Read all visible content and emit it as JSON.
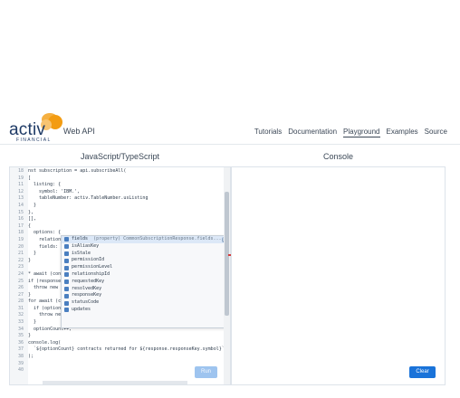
{
  "header": {
    "logo_word": "activ",
    "logo_sub": "FINANCIAL",
    "title": "Web API",
    "nav": [
      "Tutorials",
      "Documentation",
      "Playground",
      "Examples",
      "Source"
    ],
    "active_nav": "Playground"
  },
  "left_pane": {
    "title": "JavaScript/TypeScript"
  },
  "right_pane": {
    "title": "Console"
  },
  "editor": {
    "lines": [
      {
        "num": "18",
        "code": "nst subscription = api.subscribeAll("
      },
      {
        "num": "19",
        "code": "["
      },
      {
        "num": "11",
        "code": "  listing: {"
      },
      {
        "num": "12",
        "code": "    symbol: 'IBM.',"
      },
      {
        "num": "13",
        "code": "    tableNumber: activ.TableNumber.usListing"
      },
      {
        "num": "14",
        "code": "  }"
      },
      {
        "num": "15",
        "code": "},"
      },
      {
        "num": "16",
        "code": "[],"
      },
      {
        "num": "17",
        "code": "{"
      },
      {
        "num": "18",
        "code": "  options: {"
      },
      {
        "num": "19",
        "code": "    relations"
      },
      {
        "num": "20",
        "code": "    fields: ["
      },
      {
        "num": "21",
        "code": "  }"
      },
      {
        "num": "22",
        "code": "}"
      },
      {
        "num": "23",
        "code": ""
      },
      {
        "num": "24",
        "code": "* await (cons"
      },
      {
        "num": "25",
        "code": "if (response."
      },
      {
        "num": "26",
        "code": "  throw new a"
      },
      {
        "num": "27",
        "code": "}"
      },
      {
        "num": "28",
        "code": "for await (co"
      },
      {
        "num": "31",
        "code": "  if (option."
      },
      {
        "num": "32",
        "code": "    throw new activ.StatusCodeError(option.statusCode);"
      },
      {
        "num": "33",
        "code": "  }"
      },
      {
        "num": "34",
        "code": "  optionCount++;"
      },
      {
        "num": "35",
        "code": "}"
      },
      {
        "num": "36",
        "code": "console.log("
      },
      {
        "num": "37",
        "code": "  `${optionCount} contracts returned for ${response.responseKey.symbol}`"
      },
      {
        "num": "38",
        "code": ");"
      },
      {
        "num": "39",
        "code": ""
      },
      {
        "num": "40",
        "code": ""
      }
    ],
    "line31_tail": "== activ.StatusCode.success) {"
  },
  "autocomplete": {
    "items": [
      {
        "label": "fields",
        "detail": "(property) CommonSubscriptionResponse.fields..."
      },
      {
        "label": "isAliasKey",
        "detail": ""
      },
      {
        "label": "isStale",
        "detail": ""
      },
      {
        "label": "permissionId",
        "detail": ""
      },
      {
        "label": "permissionLevel",
        "detail": ""
      },
      {
        "label": "relationshipId",
        "detail": ""
      },
      {
        "label": "requestedKey",
        "detail": ""
      },
      {
        "label": "resolvedKey",
        "detail": ""
      },
      {
        "label": "responseKey",
        "detail": ""
      },
      {
        "label": "statusCode",
        "detail": ""
      },
      {
        "label": "updates",
        "detail": ""
      }
    ],
    "info_glyph": "i"
  },
  "buttons": {
    "run": "Run",
    "clear": "Clear"
  },
  "colors": {
    "accent": "#1a73d9",
    "run_disabled": "#9ec4ef",
    "logo_orange": "#f5a623",
    "logo_navy": "#1e3a66"
  }
}
